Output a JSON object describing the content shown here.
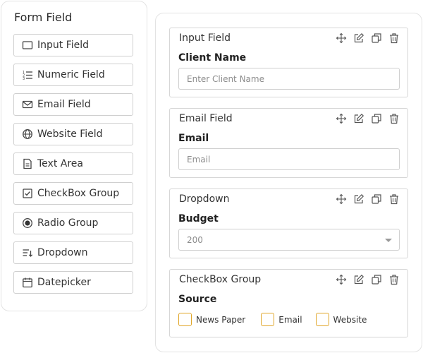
{
  "palette": {
    "title": "Form Field",
    "items": [
      {
        "label": "Input Field",
        "icon": "input-box-icon"
      },
      {
        "label": "Numeric Field",
        "icon": "numbered-list-icon"
      },
      {
        "label": "Email Field",
        "icon": "envelope-icon"
      },
      {
        "label": "Website Field",
        "icon": "globe-icon"
      },
      {
        "label": "Text Area",
        "icon": "document-icon"
      },
      {
        "label": "CheckBox Group",
        "icon": "checkbox-icon"
      },
      {
        "label": "Radio Group",
        "icon": "radio-icon"
      },
      {
        "label": "Dropdown",
        "icon": "dropdown-list-icon"
      },
      {
        "label": "Datepicker",
        "icon": "calendar-icon"
      }
    ]
  },
  "canvas": {
    "cards": [
      {
        "title": "Input Field",
        "label": "Client Name",
        "placeholder": "Enter Client Name",
        "value": ""
      },
      {
        "title": "Email Field",
        "label": "Email",
        "placeholder": "Email",
        "value": ""
      },
      {
        "title": "Dropdown",
        "label": "Budget",
        "selected": "200"
      },
      {
        "title": "CheckBox Group",
        "label": "Source",
        "options": [
          "News Paper",
          "Email",
          "Website"
        ]
      }
    ],
    "actions": [
      "move-icon",
      "edit-icon",
      "duplicate-icon",
      "delete-icon"
    ]
  },
  "colors": {
    "border": "#cfcfcf",
    "checkbox_accent": "#e0a526",
    "icon": "#555555"
  }
}
